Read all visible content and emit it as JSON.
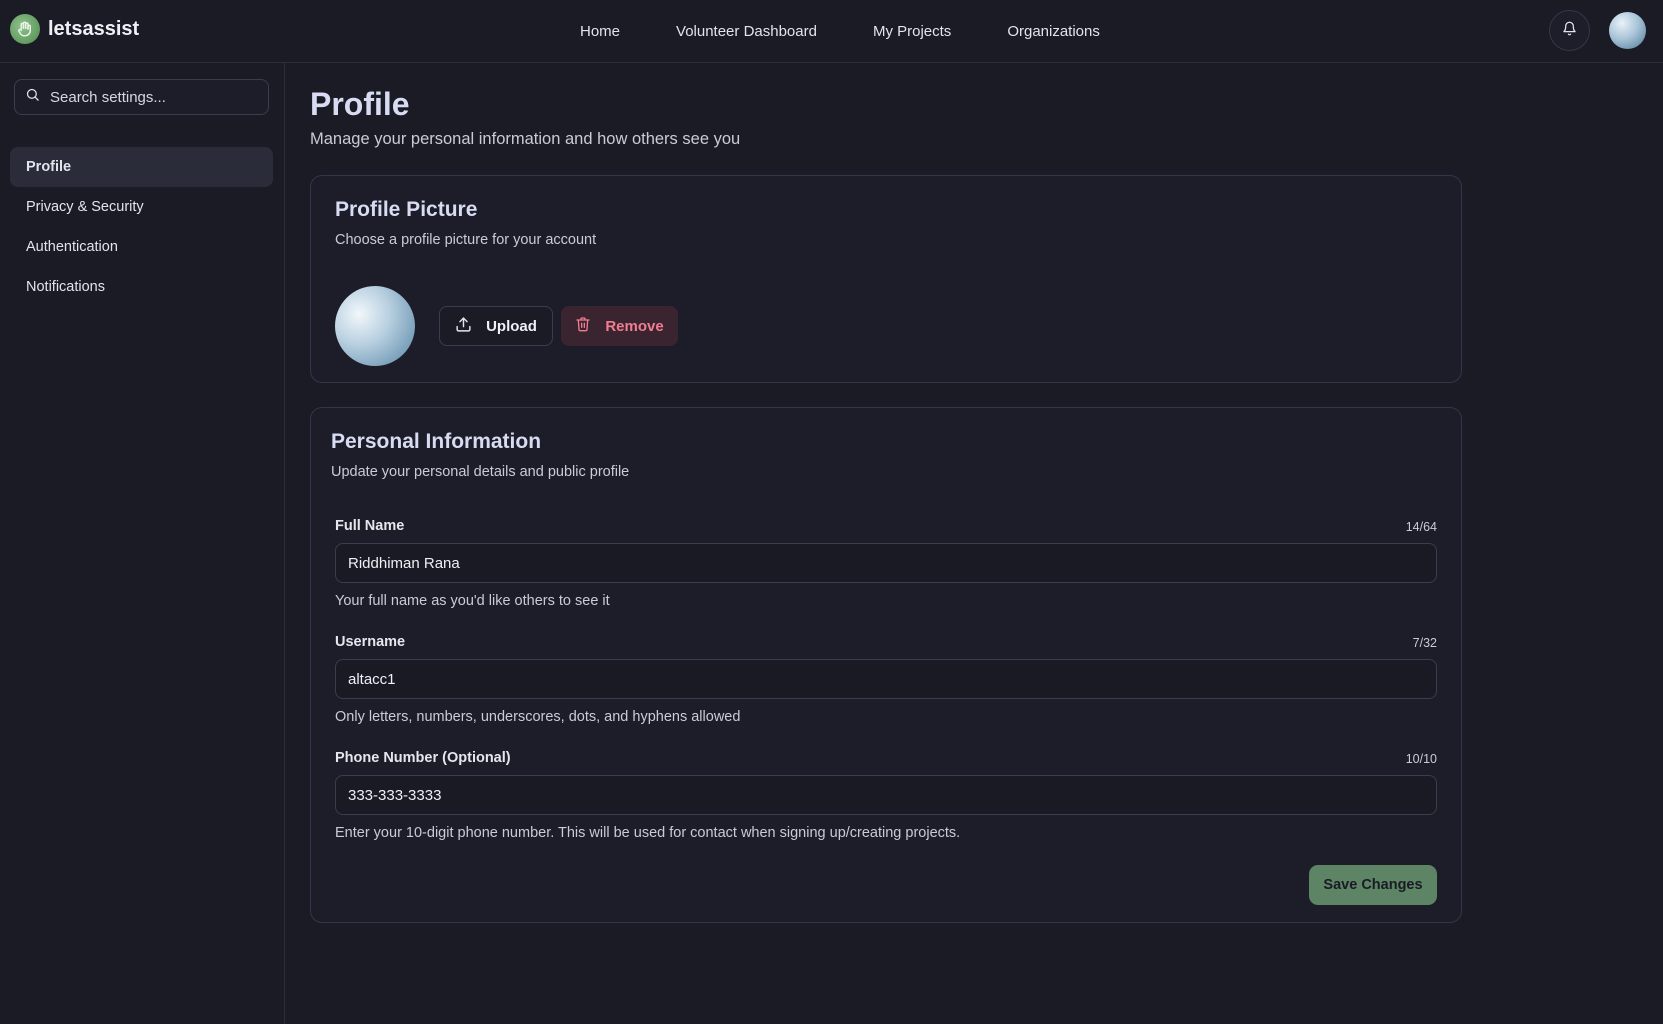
{
  "brand": {
    "name": "letsassist"
  },
  "nav": {
    "items": [
      "Home",
      "Volunteer Dashboard",
      "My Projects",
      "Organizations"
    ]
  },
  "sidebar": {
    "search": {
      "placeholder": "Search settings..."
    },
    "items": [
      {
        "label": "Profile",
        "active": true
      },
      {
        "label": "Privacy & Security",
        "active": false
      },
      {
        "label": "Authentication",
        "active": false
      },
      {
        "label": "Notifications",
        "active": false
      }
    ]
  },
  "page": {
    "title": "Profile",
    "subtitle": "Manage your personal information and how others see you"
  },
  "profile_picture": {
    "title": "Profile Picture",
    "description": "Choose a profile picture for your account",
    "upload_label": "Upload",
    "remove_label": "Remove"
  },
  "personal_info": {
    "title": "Personal Information",
    "description": "Update your personal details and public profile",
    "fields": [
      {
        "label": "Full Name",
        "counter": "14/64",
        "value": "Riddhiman Rana",
        "hint": "Your full name as you'd like others to see it"
      },
      {
        "label": "Username",
        "counter": "7/32",
        "value": "altacc1",
        "hint": "Only letters, numbers, underscores, dots, and hyphens allowed"
      },
      {
        "label": "Phone Number (Optional)",
        "counter": "10/10",
        "value": "333-333-3333",
        "hint": "Enter your 10-digit phone number. This will be used for contact when signing up/creating projects."
      }
    ],
    "save_label": "Save Changes"
  },
  "icons": {
    "logo": "hand-icon",
    "bell": "bell-icon",
    "search": "search-icon",
    "upload": "upload-icon",
    "remove": "trash-icon"
  },
  "colors": {
    "background": "#1a1b25",
    "accent": "#5d8464",
    "danger": "#f07d92"
  }
}
